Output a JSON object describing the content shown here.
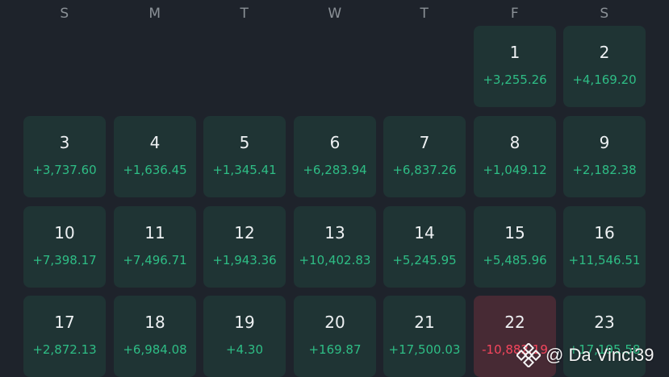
{
  "weekdays": [
    "S",
    "M",
    "T",
    "W",
    "T",
    "F",
    "S"
  ],
  "days": [
    {
      "day": "1",
      "pnl": "+3,255.26",
      "status": "profit"
    },
    {
      "day": "2",
      "pnl": "+4,169.20",
      "status": "profit"
    },
    {
      "day": "3",
      "pnl": "+3,737.60",
      "status": "profit"
    },
    {
      "day": "4",
      "pnl": "+1,636.45",
      "status": "profit"
    },
    {
      "day": "5",
      "pnl": "+1,345.41",
      "status": "profit"
    },
    {
      "day": "6",
      "pnl": "+6,283.94",
      "status": "profit"
    },
    {
      "day": "7",
      "pnl": "+6,837.26",
      "status": "profit"
    },
    {
      "day": "8",
      "pnl": "+1,049.12",
      "status": "profit"
    },
    {
      "day": "9",
      "pnl": "+2,182.38",
      "status": "profit"
    },
    {
      "day": "10",
      "pnl": "+7,398.17",
      "status": "profit"
    },
    {
      "day": "11",
      "pnl": "+7,496.71",
      "status": "profit"
    },
    {
      "day": "12",
      "pnl": "+1,943.36",
      "status": "profit"
    },
    {
      "day": "13",
      "pnl": "+10,402.83",
      "status": "profit"
    },
    {
      "day": "14",
      "pnl": "+5,245.95",
      "status": "profit"
    },
    {
      "day": "15",
      "pnl": "+5,485.96",
      "status": "profit"
    },
    {
      "day": "16",
      "pnl": "+11,546.51",
      "status": "profit"
    },
    {
      "day": "17",
      "pnl": "+2,872.13",
      "status": "profit"
    },
    {
      "day": "18",
      "pnl": "+6,984.08",
      "status": "profit"
    },
    {
      "day": "19",
      "pnl": "+4.30",
      "status": "profit"
    },
    {
      "day": "20",
      "pnl": "+169.87",
      "status": "profit"
    },
    {
      "day": "21",
      "pnl": "+17,500.03",
      "status": "profit"
    },
    {
      "day": "22",
      "pnl": "-10,882.19",
      "status": "loss"
    },
    {
      "day": "23",
      "pnl": "+17,195.58",
      "status": "profit"
    }
  ],
  "first_day_weekday_index": 5,
  "watermark": {
    "text": "@ Da Vinci39",
    "icon": "binance-logo-icon"
  },
  "colors": {
    "background": "#1e232b",
    "cell_profit_bg": "#1f3434",
    "cell_loss_bg": "#472a34",
    "profit_text": "#2ebd85",
    "loss_text": "#f6465d",
    "weekday_text": "#8b9197"
  }
}
